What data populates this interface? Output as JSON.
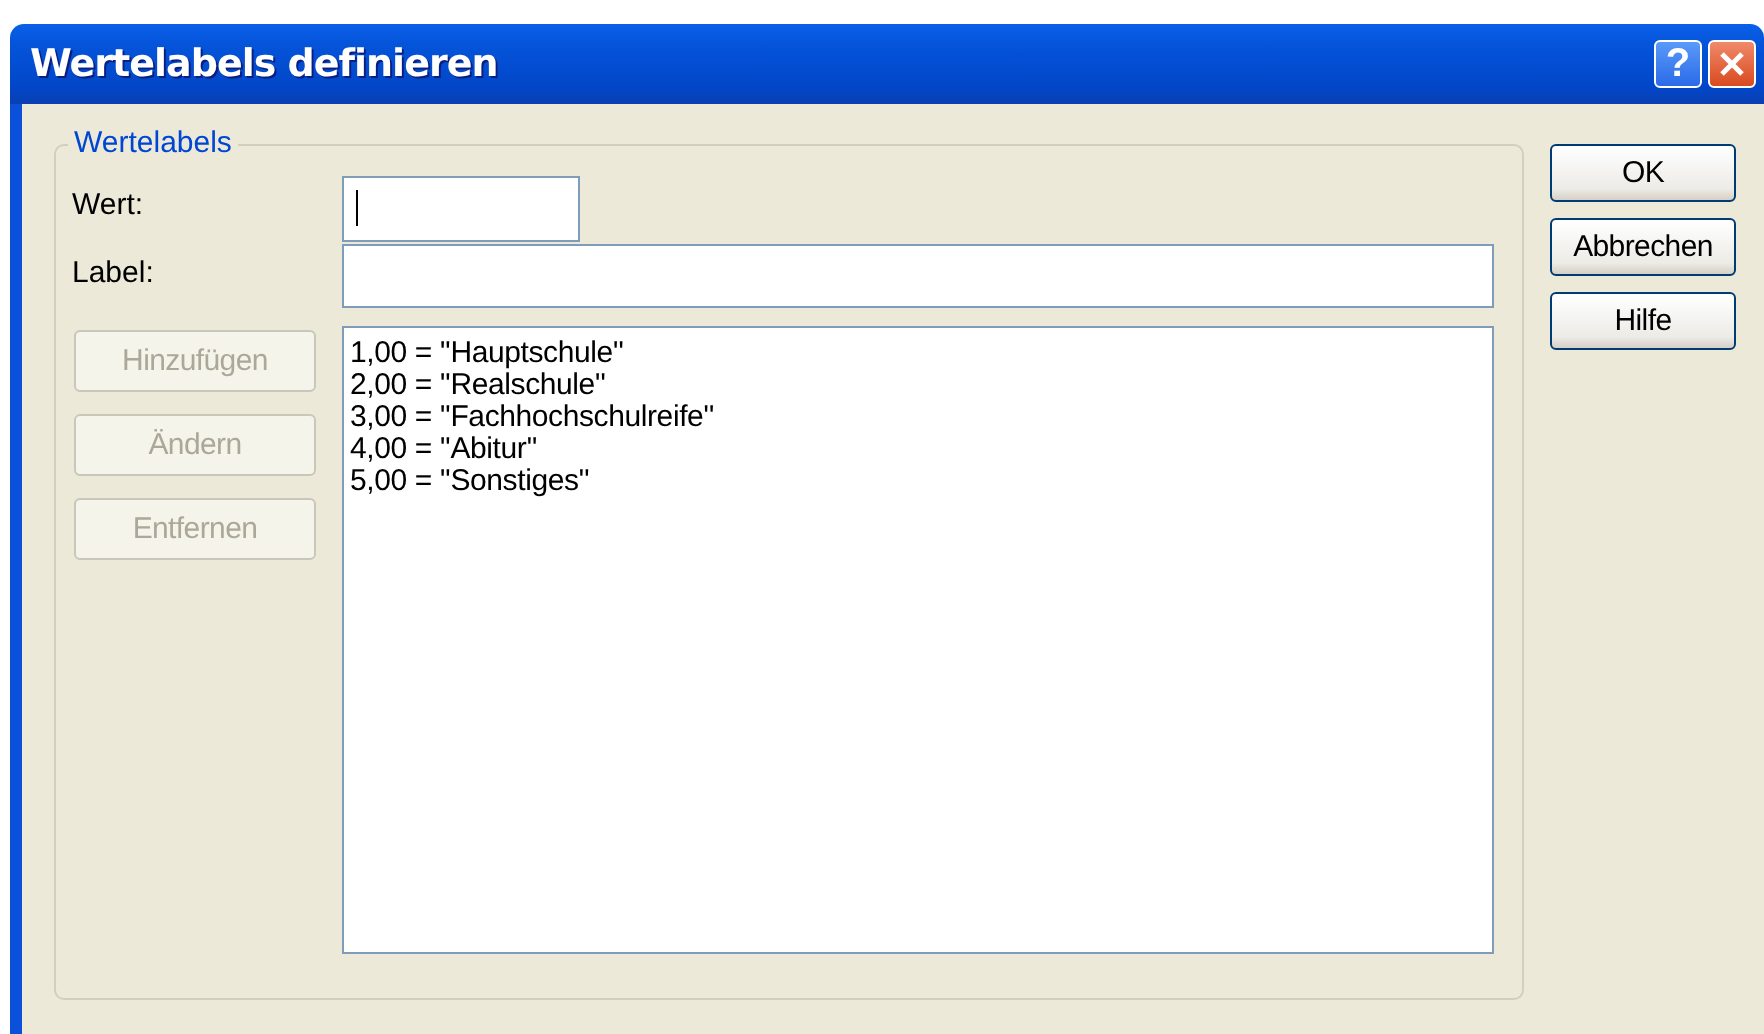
{
  "window": {
    "title": "Wertelabels definieren"
  },
  "title_buttons": [
    {
      "kind": "help",
      "label": "?"
    },
    {
      "kind": "close"
    }
  ],
  "group": {
    "legend": "Wertelabels"
  },
  "fields": [
    {
      "label": "Wert:",
      "kind": "short",
      "focused": true
    },
    {
      "label": "Label:",
      "kind": "wide",
      "focused": false
    }
  ],
  "edit_buttons": [
    {
      "label": "Hinzufügen",
      "disabled": true
    },
    {
      "label": "Ändern",
      "disabled": true
    },
    {
      "label": "Entfernen",
      "disabled": true
    }
  ],
  "list_items": [
    "1,00 = ''Hauptschule''",
    "2,00 = ''Realschule''",
    "3,00 = ''Fachhochschulreife''",
    "4,00 = ''Abitur''",
    "5,00 = ''Sonstiges''"
  ],
  "dialog_buttons": [
    "OK",
    "Abbrechen",
    "Hilfe"
  ]
}
